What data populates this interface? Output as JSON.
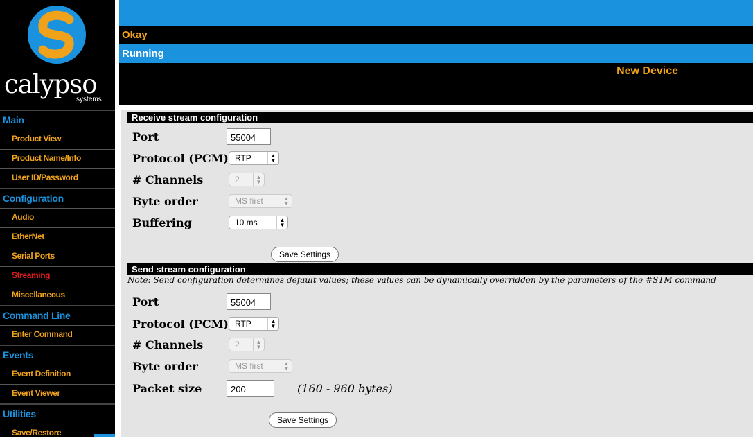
{
  "logo": {
    "wordmark": "calypso",
    "sub": "systems"
  },
  "header": {
    "status": "Okay",
    "state": "Running",
    "device_name": "New Device"
  },
  "sidebar": [
    {
      "type": "section",
      "label": "Main"
    },
    {
      "type": "item",
      "label": "Product View"
    },
    {
      "type": "item",
      "label": "Product Name/Info"
    },
    {
      "type": "item",
      "label": "User ID/Password"
    },
    {
      "type": "section",
      "label": "Configuration"
    },
    {
      "type": "item",
      "label": "Audio"
    },
    {
      "type": "item",
      "label": "EtherNet"
    },
    {
      "type": "item",
      "label": "Serial Ports"
    },
    {
      "type": "item",
      "label": "Streaming",
      "active": true
    },
    {
      "type": "item",
      "label": "Miscellaneous"
    },
    {
      "type": "section",
      "label": "Command Line"
    },
    {
      "type": "item",
      "label": "Enter Command"
    },
    {
      "type": "section",
      "label": "Events"
    },
    {
      "type": "item",
      "label": "Event Definition"
    },
    {
      "type": "item",
      "label": "Event Viewer"
    },
    {
      "type": "section",
      "label": "Utilities"
    },
    {
      "type": "item",
      "label": "Save/Restore"
    }
  ],
  "receive": {
    "title": "Receive stream configuration",
    "port_label": "Port",
    "port_value": "55004",
    "protocol_label": "Protocol (PCM)",
    "protocol_value": "RTP",
    "channels_label": "# Channels",
    "channels_value": "2",
    "byteorder_label": "Byte order",
    "byteorder_value": "MS first",
    "buffering_label": "Buffering",
    "buffering_value": "10 ms",
    "save_label": "Save Settings"
  },
  "send": {
    "title": "Send stream configuration",
    "note": "Note: Send configuration determines default values; these values can be dynamically overridden by the parameters of the #STM command",
    "port_label": "Port",
    "port_value": "55004",
    "protocol_label": "Protocol (PCM)",
    "protocol_value": "RTP",
    "channels_label": "# Channels",
    "channels_value": "2",
    "byteorder_label": "Byte order",
    "byteorder_value": "MS first",
    "packet_label": "Packet size",
    "packet_value": "200",
    "packet_range": "(160 - 960 bytes)",
    "save_label": "Save Settings"
  },
  "colors": {
    "accent_blue": "#1a92dd",
    "accent_orange": "#f0a31a",
    "active_red": "#e31b1b"
  }
}
